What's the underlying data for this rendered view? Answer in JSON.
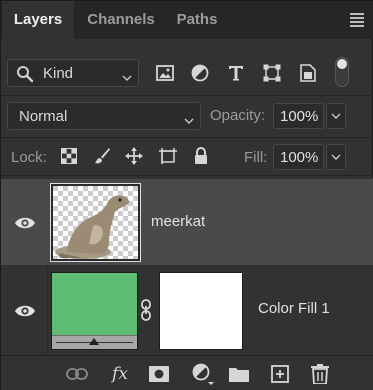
{
  "tabs": [
    {
      "label": "Layers",
      "active": true
    },
    {
      "label": "Channels",
      "active": false
    },
    {
      "label": "Paths",
      "active": false
    }
  ],
  "panel_menu_icon": "hamburger-menu-icon",
  "filter": {
    "kind_label": "Kind",
    "icons": [
      "image-filter-icon",
      "adjustment-filter-icon",
      "type-filter-icon",
      "shape-filter-icon",
      "smart-object-filter-icon"
    ],
    "toggle_state": "on"
  },
  "blend": {
    "mode": "Normal",
    "opacity_label": "Opacity:",
    "opacity_value": "100%"
  },
  "lock": {
    "label": "Lock:",
    "icons": [
      "lock-transparent-pixels-icon",
      "lock-image-pixels-icon",
      "lock-position-icon",
      "prevent-autonest-icon",
      "lock-all-icon"
    ],
    "fill_label": "Fill:",
    "fill_value": "100%"
  },
  "layers": [
    {
      "name": "meerkat",
      "visible": true,
      "selected": true,
      "type": "pixel"
    },
    {
      "name": "Color Fill 1",
      "visible": true,
      "selected": false,
      "type": "fill",
      "fill_color": "#5fbc73",
      "mask_color": "#ffffff"
    }
  ],
  "bottom_icons": [
    "link-layers-icon",
    "fx-icon",
    "add-mask-icon",
    "new-adjustment-layer-icon",
    "new-group-icon",
    "new-layer-icon",
    "delete-layer-icon"
  ],
  "fx_label": "fx",
  "colors": {
    "panel_bg": "#323232",
    "tab_bar_bg": "#262626",
    "selected_row": "#4a4a4a",
    "fill_green": "#5fbc73"
  }
}
